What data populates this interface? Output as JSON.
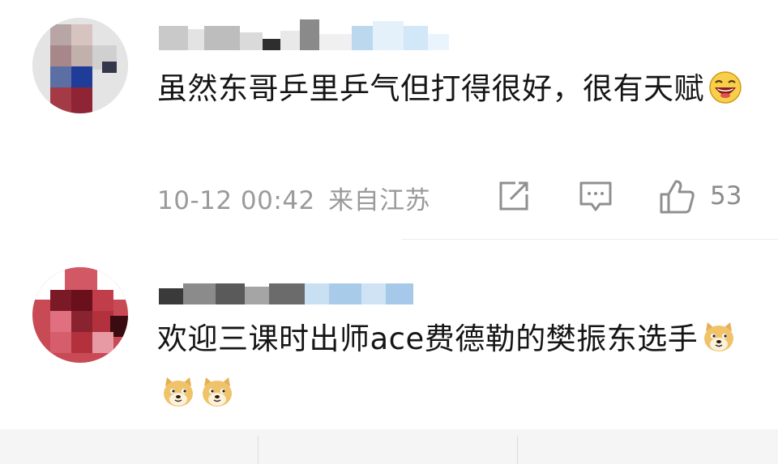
{
  "comments": [
    {
      "text": "虽然东哥乒里乒气但打得很好，很有天赋",
      "emoji": "laughing-face",
      "time": "10-12 00:42",
      "location": "来自江苏",
      "likes": "53"
    },
    {
      "text": "欢迎三课时出师ace费德勒的樊振东选手",
      "emoji": "doge"
    }
  ],
  "icons": {
    "repost": "repost-icon",
    "comment": "comment-icon",
    "like": "thumbs-up-icon"
  },
  "colors": {
    "text": "#151515",
    "meta": "#9a9a9a",
    "divider": "#ececec"
  }
}
